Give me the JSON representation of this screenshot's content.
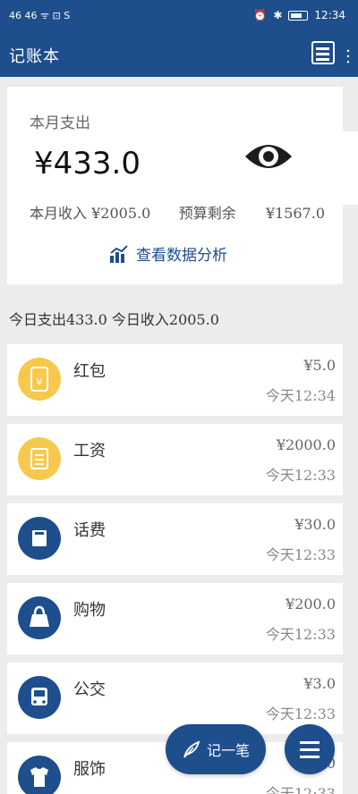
{
  "status_bar": {
    "left": "46 46 ᯤ ⊡ S",
    "time": "12:34"
  },
  "app_bar": {
    "title": "记账本",
    "overflow": "︙"
  },
  "summary": {
    "expense_label": "本月支出",
    "expense_amount": "¥433.0",
    "income_label": "本月收入",
    "income_amount": "¥2005.0",
    "remain_label": "预算剩余",
    "remain_amount": "¥1567.0",
    "analysis_link": "查看数据分析"
  },
  "today": {
    "text": "今日支出433.0 今日收入2005.0"
  },
  "records": [
    {
      "name": "红包",
      "amount": "¥5.0",
      "time": "今天12:34",
      "icon": "red-envelope-icon",
      "color": "#f6c94e"
    },
    {
      "name": "工资",
      "amount": "¥2000.0",
      "time": "今天12:33",
      "icon": "salary-icon",
      "color": "#f6c94e"
    },
    {
      "name": "话费",
      "amount": "¥30.0",
      "time": "今天12:33",
      "icon": "phone-bill-icon",
      "color": "#1e4e8c"
    },
    {
      "name": "购物",
      "amount": "¥200.0",
      "time": "今天12:33",
      "icon": "shopping-bag-icon",
      "color": "#1e4e8c"
    },
    {
      "name": "公交",
      "amount": "¥3.0",
      "time": "今天12:33",
      "icon": "bus-icon",
      "color": "#1e4e8c"
    },
    {
      "name": "服饰",
      "amount": "¥0",
      "time": "今天12:33",
      "icon": "clothing-icon",
      "color": "#1e4e8c"
    }
  ],
  "fab": {
    "add_label": "记一笔"
  },
  "colors": {
    "primary": "#1e4e8c",
    "income": "#f6c94e"
  }
}
